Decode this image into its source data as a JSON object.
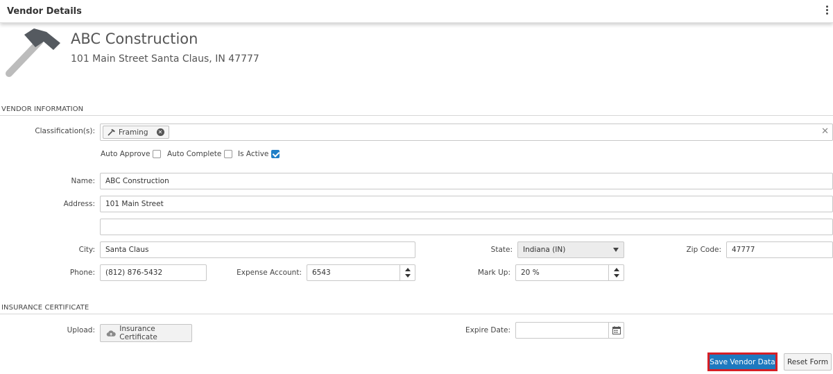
{
  "panel": {
    "title": "Vendor Details"
  },
  "vendor": {
    "name": "ABC Construction",
    "address_line": "101 Main Street Santa Claus, IN 47777"
  },
  "sections": {
    "vendor_info": "VENDOR INFORMATION",
    "insurance": "INSURANCE CERTIFICATE"
  },
  "classification": {
    "label": "Classification(s):",
    "chips": [
      "Framing"
    ]
  },
  "checkboxes": {
    "auto_approve": {
      "label": "Auto Approve",
      "checked": false
    },
    "auto_complete": {
      "label": "Auto Complete",
      "checked": false
    },
    "is_active": {
      "label": "Is Active",
      "checked": true
    }
  },
  "form": {
    "name_label": "Name:",
    "name_value": "ABC Construction",
    "address_label": "Address:",
    "address1_value": "101 Main Street",
    "address2_value": "",
    "city_label": "City:",
    "city_value": "Santa Claus",
    "state_label": "State:",
    "state_value": "Indiana (IN)",
    "zip_label": "Zip Code:",
    "zip_value": "47777",
    "phone_label": "Phone:",
    "phone_value": "(812) 876-5432",
    "expense_label": "Expense Account:",
    "expense_value": "6543",
    "markup_label": "Mark Up:",
    "markup_value": "20 %"
  },
  "insurance": {
    "upload_label": "Upload:",
    "upload_button": "Insurance Certificate",
    "expire_label": "Expire Date:",
    "expire_value": ""
  },
  "actions": {
    "save": "Save Vendor Data",
    "reset": "Reset Form"
  },
  "colors": {
    "primary": "#1e79bf",
    "highlight_border": "#d61f26",
    "icon_dark": "#555a60",
    "icon_light": "#bcbcbc"
  },
  "icons": [
    "hammer-icon",
    "kebab-menu-icon",
    "chip-remove-icon",
    "clear-icon",
    "caret-down-icon",
    "spinner-icon",
    "cloud-upload-icon",
    "calendar-icon"
  ]
}
